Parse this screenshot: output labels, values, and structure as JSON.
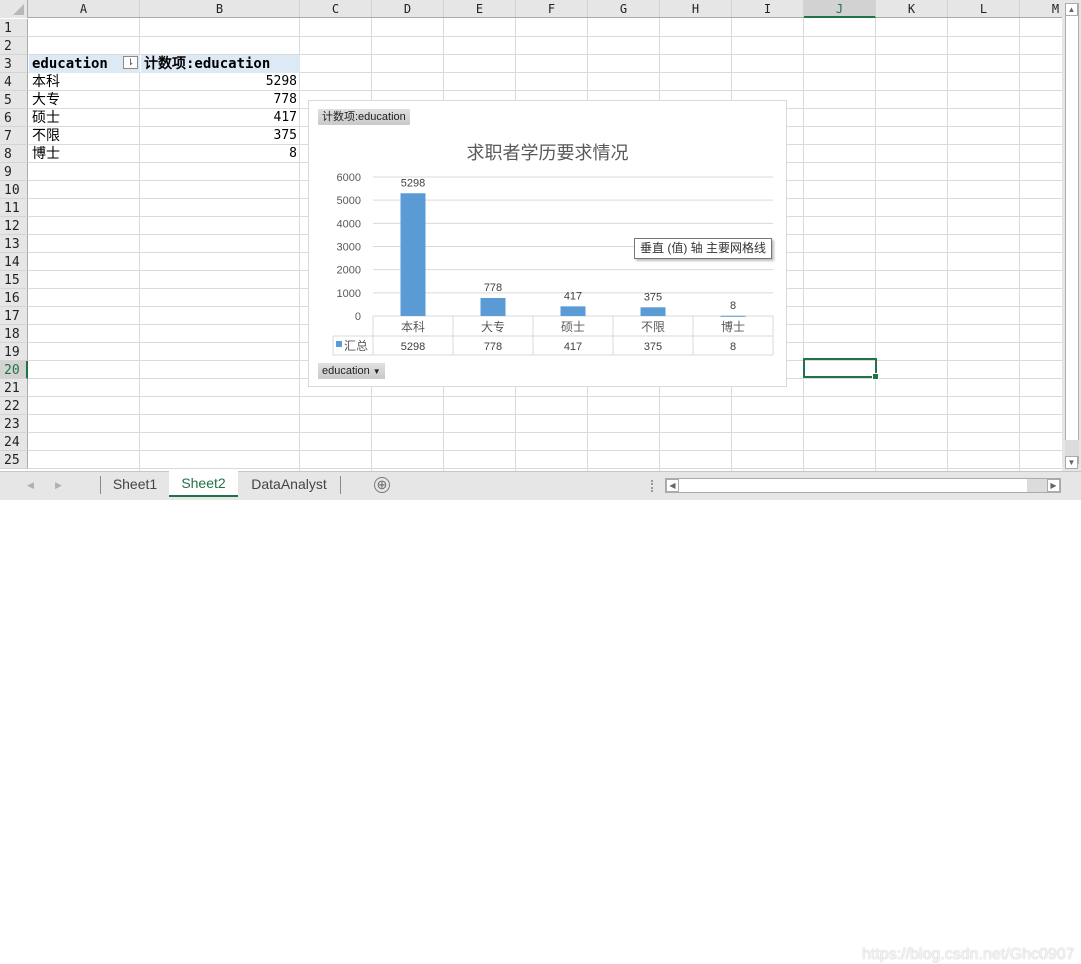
{
  "columns": [
    "A",
    "B",
    "C",
    "D",
    "E",
    "F",
    "G",
    "H",
    "I",
    "J",
    "K",
    "L",
    "M"
  ],
  "selected_column": "J",
  "rows": [
    "1",
    "2",
    "3",
    "4",
    "5",
    "6",
    "7",
    "8",
    "9",
    "10",
    "11",
    "12",
    "13",
    "14",
    "15",
    "16",
    "17",
    "18",
    "19",
    "20",
    "21",
    "22",
    "23",
    "24",
    "25"
  ],
  "selected_row": "20",
  "pivot": {
    "header_row_label": "education",
    "header_value_label": "计数项:education",
    "items": [
      {
        "label": "本科",
        "value": "5298"
      },
      {
        "label": "大专",
        "value": "778"
      },
      {
        "label": "硕士",
        "value": "417"
      },
      {
        "label": "不限",
        "value": "375"
      },
      {
        "label": "博士",
        "value": "8"
      }
    ]
  },
  "chart": {
    "value_field_button": "计数项:education",
    "axis_field_button": "education",
    "tooltip": "垂直 (值) 轴 主要网格线",
    "legend_label": "汇总",
    "series_color": "#5b9bd5"
  },
  "chart_data": {
    "type": "bar",
    "title": "求职者学历要求情况",
    "categories": [
      "本科",
      "大专",
      "硕士",
      "不限",
      "博士"
    ],
    "series": [
      {
        "name": "汇总",
        "values": [
          5298,
          778,
          417,
          375,
          8
        ]
      }
    ],
    "data_labels": [
      "5298",
      "778",
      "417",
      "375",
      "8"
    ],
    "yticks": [
      "0",
      "1000",
      "2000",
      "3000",
      "4000",
      "5000",
      "6000"
    ],
    "ylim": [
      0,
      6000
    ],
    "xlabel": "",
    "ylabel": "",
    "grid": true,
    "data_table": true
  },
  "sheets": {
    "tabs": [
      "Sheet1",
      "Sheet2",
      "DataAnalyst"
    ],
    "active": "Sheet2",
    "add_icon": "⊕"
  },
  "watermark": "https://blog.csdn.net/Ghc0907"
}
